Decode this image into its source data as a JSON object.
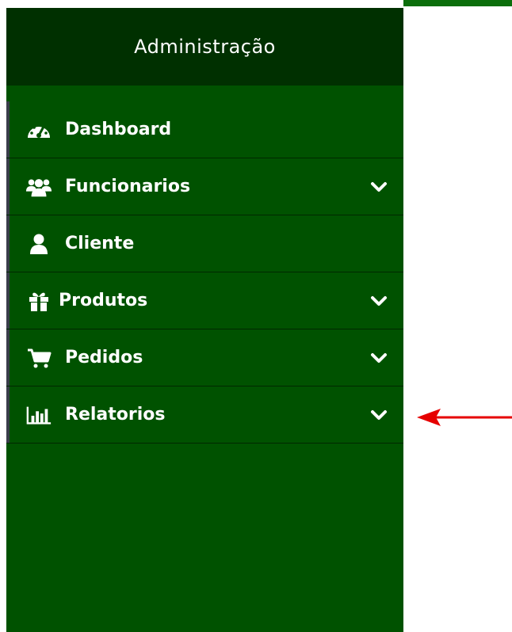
{
  "sidebar": {
    "header_title": "Administração",
    "items": [
      {
        "label": "Dashboard",
        "icon": "dashboard-icon",
        "has_submenu": false
      },
      {
        "label": "Funcionarios",
        "icon": "users-icon",
        "has_submenu": true
      },
      {
        "label": "Cliente",
        "icon": "user-icon",
        "has_submenu": false
      },
      {
        "label": "Produtos",
        "icon": "gift-icon",
        "has_submenu": true
      },
      {
        "label": "Pedidos",
        "icon": "cart-icon",
        "has_submenu": true
      },
      {
        "label": "Relatorios",
        "icon": "bar-chart-icon",
        "has_submenu": true
      }
    ]
  },
  "colors": {
    "sidebar_bg": "#005200",
    "header_bg": "#003000",
    "text": "#ffffff",
    "annotation_arrow": "#e60000"
  }
}
